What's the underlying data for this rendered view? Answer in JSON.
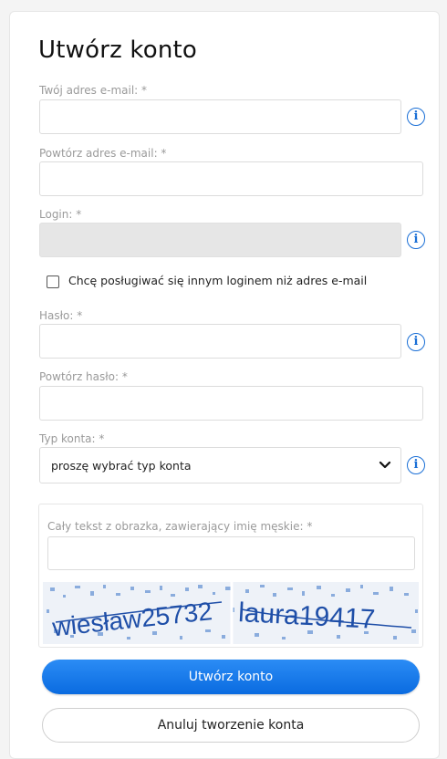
{
  "form": {
    "title": "Utwórz konto",
    "email_label": "Twój adres e-mail: *",
    "email_value": "",
    "email_confirm_label": "Powtórz adres e-mail: *",
    "email_confirm_value": "",
    "login_label": "Login: *",
    "login_value": "",
    "custom_login_checkbox_label": "Chcę posługiwać się innym loginem niż adres e-mail",
    "custom_login_checked": false,
    "password_label": "Hasło: *",
    "password_value": "",
    "password_confirm_label": "Powtórz hasło: *",
    "password_confirm_value": "",
    "account_type_label": "Typ konta: *",
    "account_type_selected": "proszę wybrać typ konta"
  },
  "captcha": {
    "label": "Cały tekst z obrazka, zawierający imię męskie: *",
    "value": "",
    "word1": "wiesław25732",
    "word2": "laura19417"
  },
  "buttons": {
    "create": "Utwórz konto",
    "cancel": "Anuluj tworzenie konta"
  },
  "colors": {
    "accent": "#0a6be0",
    "info_icon": "#1a6fd6",
    "captcha_text": "#1f4fa8"
  },
  "icons": {
    "info": "info-circle-icon",
    "chevron": "chevron-down-icon"
  }
}
